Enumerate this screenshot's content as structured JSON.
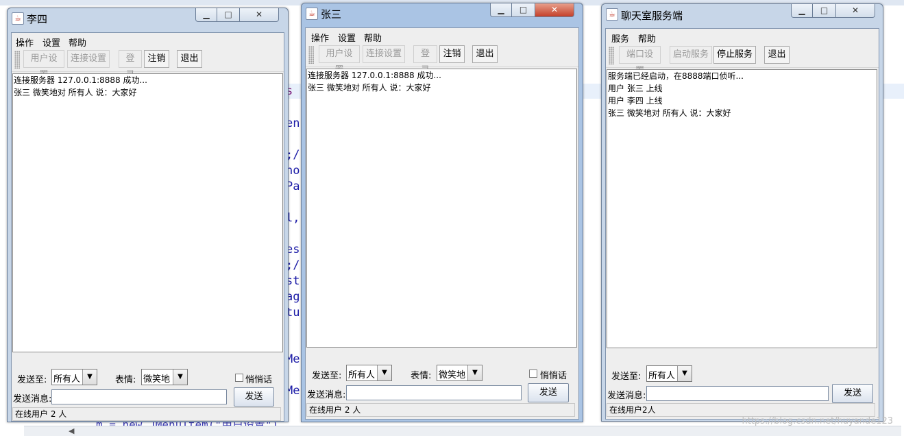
{
  "background": {
    "code_lines": [
      "s",
      "en",
      ";/",
      "ho",
      "Pa",
      "l,",
      "es",
      ";/",
      "st",
      "ag",
      "tu",
      "Me",
      "Me"
    ],
    "bottom_code": "m = new JMenuItem(\"用户设置\")",
    "watermark": "https://blog.csdn.net/huyande123"
  },
  "client_lisi": {
    "title": "李四",
    "menu": [
      "操作",
      "设置",
      "帮助"
    ],
    "toolbar": {
      "user_settings": "用户设置",
      "connect_settings": "连接设置",
      "login": "登录",
      "logout": "注销",
      "exit": "退出"
    },
    "messages": [
      "连接服务器 127.0.0.1:8888 成功...",
      "张三 微笑地对 所有人 说：大家好"
    ],
    "send_to_label": "发送至:",
    "send_to_value": "所有人",
    "expression_label": "表情:",
    "expression_value": "微笑地",
    "whisper_label": "悄悄话",
    "message_label": "发送消息:",
    "message_value": "",
    "send_button": "发送",
    "status": "在线用户 2 人"
  },
  "client_zhangsan": {
    "title": "张三",
    "menu": [
      "操作",
      "设置",
      "帮助"
    ],
    "toolbar": {
      "user_settings": "用户设置",
      "connect_settings": "连接设置",
      "login": "登录",
      "logout": "注销",
      "exit": "退出"
    },
    "messages": [
      "连接服务器 127.0.0.1:8888 成功...",
      "张三 微笑地对 所有人 说：大家好"
    ],
    "send_to_label": "发送至:",
    "send_to_value": "所有人",
    "expression_label": "表情:",
    "expression_value": "微笑地",
    "whisper_label": "悄悄话",
    "message_label": "发送消息:",
    "message_value": "",
    "send_button": "发送",
    "status": "在线用户 2 人"
  },
  "server": {
    "title": "聊天室服务端",
    "menu": [
      "服务",
      "帮助"
    ],
    "toolbar": {
      "port_settings": "端口设置",
      "start_service": "启动服务",
      "stop_service": "停止服务",
      "exit": "退出"
    },
    "messages": [
      "服务端已经启动，在8888端口侦听...",
      "用户 张三 上线",
      "用户 李四 上线",
      "张三 微笑地对 所有人 说：大家好"
    ],
    "send_to_label": "发送至:",
    "send_to_value": "所有人",
    "message_label": "发送消息:",
    "message_value": "",
    "send_button": "发送",
    "status": "在线用户2人"
  },
  "colors": {
    "window_frame": "#c7d6e8",
    "active_frame": "#aac4e4",
    "close_active": "#c4402a",
    "panel": "#eeeeee"
  }
}
